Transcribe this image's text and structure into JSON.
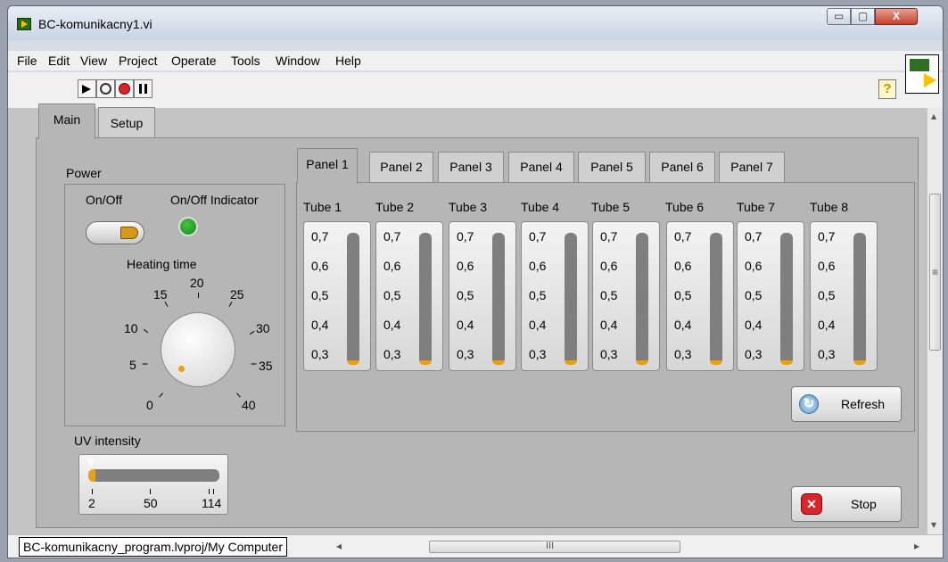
{
  "window": {
    "title": "BC-komunikacny1.vi",
    "min_glyph": "▭",
    "max_glyph": "▢",
    "close_glyph": "X"
  },
  "menu": [
    "File",
    "Edit",
    "View",
    "Project",
    "Operate",
    "Tools",
    "Window",
    "Help"
  ],
  "toolbar": {
    "help_glyph": "?"
  },
  "outer_tabs": [
    {
      "label": "Main",
      "selected": true
    },
    {
      "label": "Setup",
      "selected": false
    }
  ],
  "power": {
    "section_label": "Power",
    "switch_label": "On/Off",
    "indicator_label": "On/Off Indicator",
    "indicator_color": "#1a8a1a",
    "heating_label": "Heating time",
    "dial_ticks": [
      "0",
      "5",
      "10",
      "15",
      "20",
      "25",
      "30",
      "35",
      "40"
    ],
    "dial_value": 5
  },
  "uv": {
    "label": "UV intensity",
    "ticks": [
      "2",
      "50",
      "114"
    ],
    "value": 2,
    "min": 2,
    "max": 114
  },
  "inner_tabs": [
    {
      "label": "Panel 1",
      "selected": true
    },
    {
      "label": "Panel 2",
      "selected": false
    },
    {
      "label": "Panel 3",
      "selected": false
    },
    {
      "label": "Panel 4",
      "selected": false
    },
    {
      "label": "Panel 5",
      "selected": false
    },
    {
      "label": "Panel 6",
      "selected": false
    },
    {
      "label": "Panel 7",
      "selected": false
    }
  ],
  "tubes": {
    "labels": [
      "Tube 1",
      "Tube 2",
      "Tube 3",
      "Tube 4",
      "Tube 5",
      "Tube 6",
      "Tube 7",
      "Tube 8"
    ],
    "scale": [
      "0,7",
      "0,6",
      "0,5",
      "0,4",
      "0,3"
    ],
    "level_color": "#e4a11b"
  },
  "buttons": {
    "refresh": "Refresh",
    "stop": "Stop"
  },
  "status": {
    "path": "BC-komunikacny_program.lvproj/My Computer",
    "scroll_left": "◂",
    "scroll_right": "▸",
    "scroll_grip": "III"
  },
  "vscroll": {
    "up": "▴",
    "down": "▾",
    "grip": "≡"
  }
}
